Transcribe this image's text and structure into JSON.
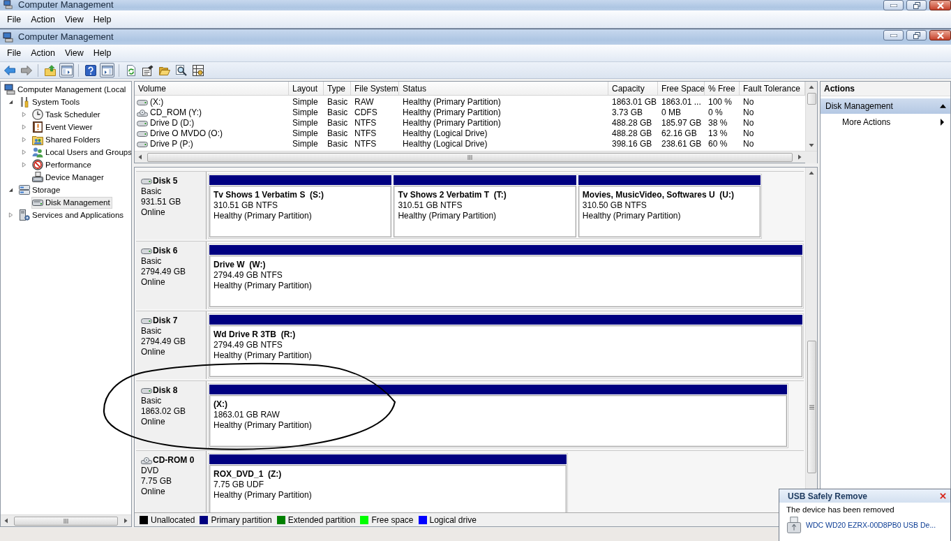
{
  "outer_window": {
    "title": "Computer Management",
    "menu": [
      "File",
      "Action",
      "View",
      "Help"
    ]
  },
  "window": {
    "title": "Computer Management",
    "menu": [
      "File",
      "Action",
      "View",
      "Help"
    ]
  },
  "toolbar": {
    "groups": [
      [
        {
          "kind": "back",
          "pressed": false
        },
        {
          "kind": "forward",
          "pressed": false
        }
      ],
      [
        {
          "kind": "up",
          "pressed": false
        },
        {
          "kind": "console-tree",
          "pressed": true
        }
      ],
      [
        {
          "kind": "help",
          "pressed": false
        },
        {
          "kind": "action-pane",
          "pressed": true
        }
      ],
      [
        {
          "kind": "refresh",
          "pressed": false
        },
        {
          "kind": "properties",
          "pressed": false
        },
        {
          "kind": "open",
          "pressed": false
        },
        {
          "kind": "find",
          "pressed": false
        },
        {
          "kind": "settings",
          "pressed": false
        }
      ]
    ]
  },
  "tree": {
    "items": [
      {
        "label": "Computer Management (Local",
        "kind": "computer",
        "selected": false,
        "children": [
          {
            "label": "System Tools",
            "kind": "tools",
            "expanded": true,
            "selected": false,
            "children": [
              {
                "label": "Task Scheduler",
                "kind": "clock",
                "expanded": false,
                "selected": false
              },
              {
                "label": "Event Viewer",
                "kind": "log",
                "expanded": false,
                "selected": false
              },
              {
                "label": "Shared Folders",
                "kind": "shared",
                "expanded": false,
                "selected": false
              },
              {
                "label": "Local Users and Groups",
                "kind": "users",
                "expanded": false,
                "selected": false
              },
              {
                "label": "Performance",
                "kind": "performance",
                "expanded": false,
                "selected": false
              },
              {
                "label": "Device Manager",
                "kind": "devices",
                "selected": false
              }
            ]
          },
          {
            "label": "Storage",
            "kind": "storage",
            "expanded": true,
            "selected": false,
            "children": [
              {
                "label": "Disk Management",
                "kind": "disk",
                "selected": true
              }
            ]
          },
          {
            "label": "Services and Applications",
            "kind": "services",
            "expanded": false,
            "selected": false
          }
        ]
      }
    ]
  },
  "volumes": {
    "columns": [
      "Volume",
      "Layout",
      "Type",
      "File System",
      "Status",
      "Capacity",
      "Free Space",
      "% Free",
      "Fault Tolerance"
    ],
    "rows": [
      {
        "kind": "drive",
        "cells": [
          "(X:)",
          "Simple",
          "Basic",
          "RAW",
          "Healthy (Primary Partition)",
          "1863.01 GB",
          "1863.01 ...",
          "100 %",
          "No"
        ]
      },
      {
        "kind": "cd",
        "cells": [
          "CD_ROM (Y:)",
          "Simple",
          "Basic",
          "CDFS",
          "Healthy (Primary Partition)",
          "3.73 GB",
          "0 MB",
          "0 %",
          "No"
        ]
      },
      {
        "kind": "drive",
        "cells": [
          "Drive D (D:)",
          "Simple",
          "Basic",
          "NTFS",
          "Healthy (Primary Partition)",
          "488.28 GB",
          "185.97 GB",
          "38 %",
          "No"
        ]
      },
      {
        "kind": "drive",
        "cells": [
          "Drive O MVDO (O:)",
          "Simple",
          "Basic",
          "NTFS",
          "Healthy (Logical Drive)",
          "488.28 GB",
          "62.16 GB",
          "13 %",
          "No"
        ]
      },
      {
        "kind": "drive",
        "cells": [
          "Drive P (P:)",
          "Simple",
          "Basic",
          "NTFS",
          "Healthy (Logical Drive)",
          "398.16 GB",
          "238.61 GB",
          "60 %",
          "No"
        ]
      }
    ]
  },
  "disks": [
    {
      "kind": "disk",
      "name": "Disk 5",
      "type": "Basic",
      "size": "931.51 GB",
      "status": "Online",
      "partitions": [
        {
          "name": "Tv Shows 1 Verbatim S  (S:)",
          "size": "310.51 GB NTFS",
          "status": "Healthy (Primary Partition)",
          "color": "#000080"
        },
        {
          "name": "Tv Shows 2 Verbatim T  (T:)",
          "size": "310.51 GB NTFS",
          "status": "Healthy (Primary Partition)",
          "color": "#000080"
        },
        {
          "name": "Movies, MusicVideo, Softwares U  (U:)",
          "size": "310.50 GB NTFS",
          "status": "Healthy (Primary Partition)",
          "color": "#000080"
        }
      ]
    },
    {
      "kind": "disk",
      "name": "Disk 6",
      "type": "Basic",
      "size": "2794.49 GB",
      "status": "Online",
      "partitions": [
        {
          "name": "Drive W  (W:)",
          "size": "2794.49 GB NTFS",
          "status": "Healthy (Primary Partition)",
          "color": "#000080"
        }
      ]
    },
    {
      "kind": "disk",
      "name": "Disk 7",
      "type": "Basic",
      "size": "2794.49 GB",
      "status": "Online",
      "partitions": [
        {
          "name": "Wd Drive R 3TB  (R:)",
          "size": "2794.49 GB NTFS",
          "status": "Healthy (Primary Partition)",
          "color": "#000080"
        }
      ]
    },
    {
      "kind": "disk",
      "name": "Disk 8",
      "type": "Basic",
      "size": "1863.02 GB",
      "status": "Online",
      "partitions": [
        {
          "name": "(X:)",
          "size": "1863.01 GB RAW",
          "status": "Healthy (Primary Partition)",
          "color": "#000080"
        }
      ]
    },
    {
      "kind": "cdrom",
      "name": "CD-ROM 0",
      "type": "DVD",
      "size": "7.75 GB",
      "status": "Online",
      "partitions": [
        {
          "name": "ROX_DVD_1  (Z:)",
          "size": "7.75 GB UDF",
          "status": "Healthy (Primary Partition)",
          "color": "#000080"
        }
      ]
    }
  ],
  "legend": [
    {
      "label": "Unallocated",
      "color": "#000000"
    },
    {
      "label": "Primary partition",
      "color": "#000080"
    },
    {
      "label": "Extended partition",
      "color": "#008000"
    },
    {
      "label": "Free space",
      "color": "#00ff00"
    },
    {
      "label": "Logical drive",
      "color": "#0000ff"
    }
  ],
  "actions": {
    "title": "Actions",
    "items": [
      {
        "kind": "section",
        "label": "Disk Management",
        "expanded": true
      },
      {
        "kind": "submenu",
        "label": "More Actions"
      }
    ]
  },
  "notification": {
    "title": "USB Safely Remove",
    "message": "The device has been removed",
    "device": "WDC WD20 EZRX-00D8PB0 USB De..."
  },
  "annotations": [
    {
      "kind": "ellipse"
    }
  ]
}
